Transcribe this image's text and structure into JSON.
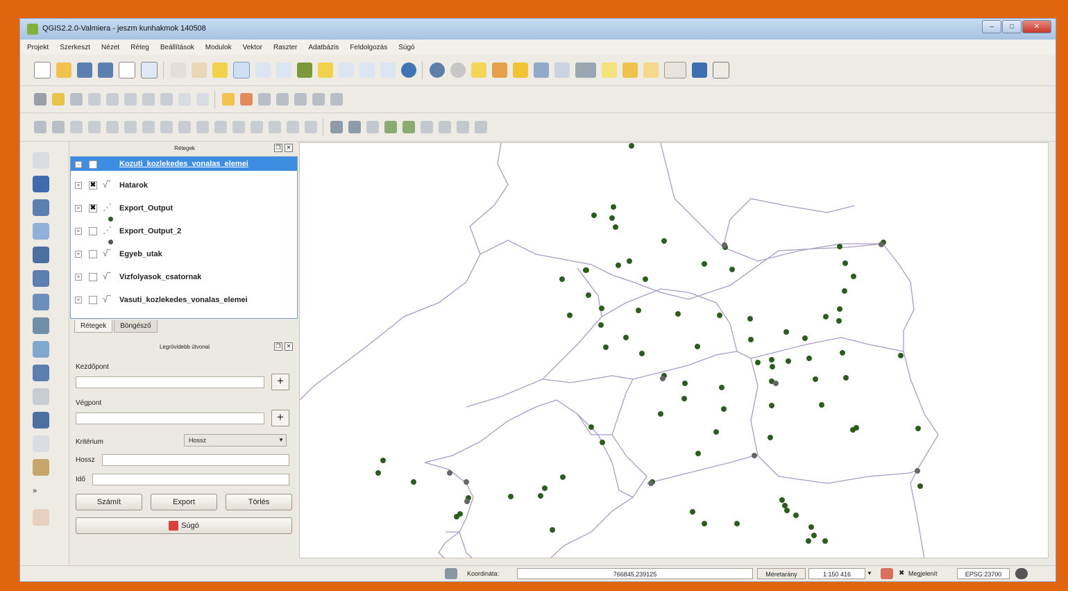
{
  "window": {
    "title": "QGIS2.2.0-Valmiera - jeszm kunhakmok 140508"
  },
  "menu": [
    "Projekt",
    "Szerkeszt",
    "Nézet",
    "Réteg",
    "Beállítások",
    "Modulok",
    "Vektor",
    "Raszter",
    "Adatbázis",
    "Feldolgozás",
    "Súgó"
  ],
  "layers_panel": {
    "title": "Rétegek",
    "layers": [
      {
        "name": "Kozuti_kozlekedes_vonalas_elemei",
        "checked": false,
        "selected": true
      },
      {
        "name": "Hatarok",
        "checked": true
      },
      {
        "name": "Export_Output",
        "checked": true
      },
      {
        "name": "Export_Output_2",
        "checked": false
      },
      {
        "name": "Egyeb_utak",
        "checked": false
      },
      {
        "name": "Vizfolyasok_csatornak",
        "checked": false
      },
      {
        "name": "Vasuti_kozlekedes_vonalas_elemei",
        "checked": false
      }
    ],
    "tabs": [
      "Rétegek",
      "Böngésző"
    ]
  },
  "route_panel": {
    "title": "Legrövidebb útvonal",
    "start_label": "Kezdőpont",
    "end_label": "Végpont",
    "criterion_label": "Kritérium",
    "criterion_value": "Hossz",
    "length_label": "Hossz",
    "time_label": "Idő",
    "calc_button": "Számít",
    "export_button": "Export",
    "delete_button": "Törlés",
    "help_button": "Súgó"
  },
  "statusbar": {
    "coord_label": "Koordináta:",
    "coord_value": "766845,239125",
    "scale_label": "Méretarány",
    "scale_value": "1:150 416",
    "render_label": "Megjelenít",
    "crs": "EPSG:23700"
  },
  "colors": {
    "accent_frame": "#e1640e",
    "point_color": "#2b5e1e",
    "boundary_color": "#a89bc6",
    "selection": "#3d8ee2"
  }
}
